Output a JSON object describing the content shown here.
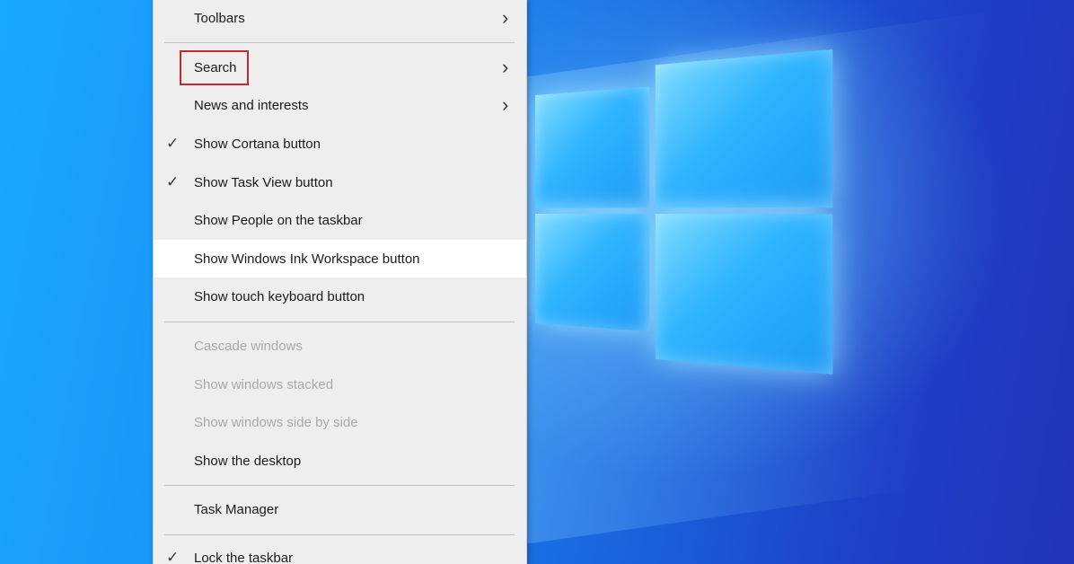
{
  "colors": {
    "menu_background": "#eeeeee",
    "hover_row": "#ffffff",
    "highlight_border": "#c5282d",
    "disabled_text": "#a9a9a9",
    "desktop_blue": "#1b8cf2"
  },
  "menu": {
    "items": [
      {
        "label": "Toolbars",
        "checked": false,
        "submenu": true,
        "enabled": true
      },
      {
        "label": "Search",
        "checked": false,
        "submenu": true,
        "enabled": true,
        "highlighted": true
      },
      {
        "label": "News and interests",
        "checked": false,
        "submenu": true,
        "enabled": true
      },
      {
        "label": "Show Cortana button",
        "checked": true,
        "submenu": false,
        "enabled": true
      },
      {
        "label": "Show Task View button",
        "checked": true,
        "submenu": false,
        "enabled": true
      },
      {
        "label": "Show People on the taskbar",
        "checked": false,
        "submenu": false,
        "enabled": true
      },
      {
        "label": "Show Windows Ink Workspace button",
        "checked": false,
        "submenu": false,
        "enabled": true,
        "hovered": true
      },
      {
        "label": "Show touch keyboard button",
        "checked": false,
        "submenu": false,
        "enabled": true
      },
      {
        "label": "Cascade windows",
        "checked": false,
        "submenu": false,
        "enabled": false
      },
      {
        "label": "Show windows stacked",
        "checked": false,
        "submenu": false,
        "enabled": false
      },
      {
        "label": "Show windows side by side",
        "checked": false,
        "submenu": false,
        "enabled": false
      },
      {
        "label": "Show the desktop",
        "checked": false,
        "submenu": false,
        "enabled": true
      },
      {
        "label": "Task Manager",
        "checked": false,
        "submenu": false,
        "enabled": true
      },
      {
        "label": "Lock the taskbar",
        "checked": true,
        "submenu": false,
        "enabled": true
      }
    ],
    "check_glyph": "✓",
    "chevron_glyph": "›"
  }
}
